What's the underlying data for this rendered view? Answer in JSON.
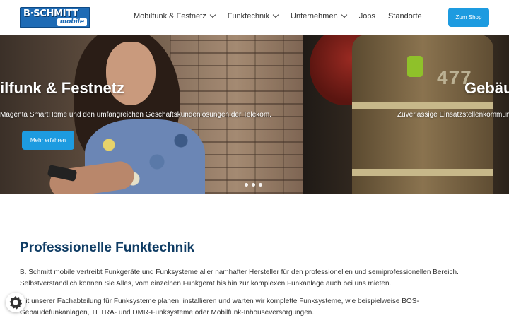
{
  "logo": {
    "line1": "B·SCHMITT",
    "line2": "mobile"
  },
  "nav": {
    "items": [
      {
        "label": "Mobilfunk & Festnetz",
        "dropdown": true
      },
      {
        "label": "Funktechnik",
        "dropdown": true
      },
      {
        "label": "Unternehmen",
        "dropdown": true
      },
      {
        "label": "Jobs",
        "dropdown": false
      },
      {
        "label": "Standorte",
        "dropdown": false
      }
    ],
    "shop_label": "Zum Shop"
  },
  "hero": {
    "slide1": {
      "title": "ilfunk & Festnetz",
      "subtitle": "Magenta SmartHome und den umfangreichen Geschäftskundenlösungen der Telekom.",
      "button_label": "Mehr erfahren"
    },
    "slide2": {
      "title": "Gebäu",
      "subtitle": "Zuverlässige Einsatzstellenkommun",
      "jacket_number": "477"
    },
    "dots": 3
  },
  "content": {
    "title": "Professionelle Funktechnik",
    "paragraph1": "B. Schmitt mobile vertreibt Funkgeräte und Funksysteme aller namhafter Hersteller für den professionellen und semiprofessionellen Bereich. Selbstverständlich können Sie Alles, vom einzelnen Funkgerät bis hin zur komplexen Funkanlage auch bei uns mieten.",
    "paragraph2": "Mit unserer Fachabteilung für Funksysteme planen, installieren und warten wir komplette Funksysteme, wie beispielweise BOS-Gebäudefunkanlagen, TETRA- und DMR-Funksysteme oder Mobilfunk-Inhouseversorgungen."
  },
  "colors": {
    "accent": "#1d9be0",
    "heading": "#0f3c64"
  },
  "cookie": {
    "icon": "cookie-settings-icon"
  }
}
